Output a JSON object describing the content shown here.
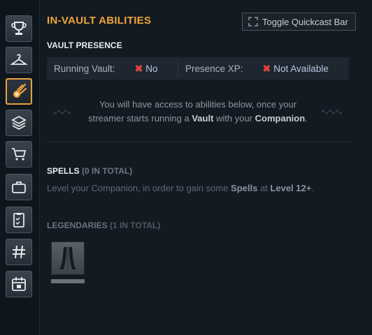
{
  "sidebar": {
    "items": [
      {
        "icon": "trophy-icon",
        "active": false
      },
      {
        "icon": "hanger-icon",
        "active": false
      },
      {
        "icon": "fireball-icon",
        "active": true
      },
      {
        "icon": "layers-icon",
        "active": false
      },
      {
        "icon": "cart-icon",
        "active": false
      },
      {
        "icon": "briefcase-icon",
        "active": false
      },
      {
        "icon": "clipboard-icon",
        "active": false
      },
      {
        "icon": "hashtag-icon",
        "active": false
      },
      {
        "icon": "calendar-icon",
        "active": false
      }
    ]
  },
  "header": {
    "title": "IN-VAULT ABILITIES",
    "toggle_label": "Toggle Quickcast Bar"
  },
  "presence": {
    "heading": "VAULT PRESENCE",
    "running_label": "Running Vault:",
    "running_value": "No",
    "xp_label": "Presence XP:",
    "xp_value": "Not Available"
  },
  "info": {
    "line1": "You will have access to abilities below, once your",
    "line2_a": "streamer starts running a ",
    "line2_vault": "Vault",
    "line2_b": " with your ",
    "line2_companion": "Companion",
    "line2_end": "."
  },
  "spells": {
    "heading": "SPELLS",
    "count": "(0 IN TOTAL)",
    "msg_a": "Level your Companion, in order to gain some ",
    "msg_spells": "Spells",
    "msg_b": " at ",
    "msg_level": "Level 12+",
    "msg_end": "."
  },
  "legendaries": {
    "heading": "LEGENDARIES",
    "count": "(1 IN TOTAL)",
    "items": [
      {
        "icon": "legendary-ability-icon"
      }
    ]
  },
  "colors": {
    "accent": "#f0a436",
    "active_border": "#e8a33b",
    "negative": "#e0443e"
  }
}
